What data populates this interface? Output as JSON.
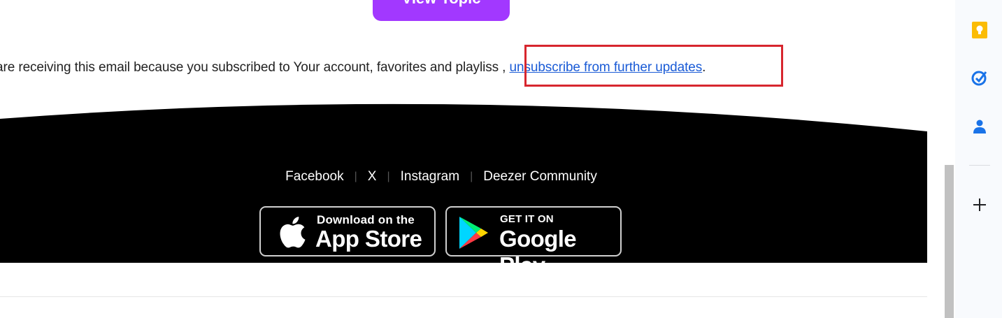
{
  "email": {
    "cta_label": "View Topic",
    "notice_text": "are receiving this email because you subscribed to Your account, favorites and playlis",
    "notice_gap": "s , ",
    "unsubscribe_link": "unsubscribe from further updates",
    "notice_end": "."
  },
  "footer": {
    "social_links": [
      {
        "label": "Facebook"
      },
      {
        "label": "X"
      },
      {
        "label": "Instagram"
      },
      {
        "label": "Deezer Community"
      }
    ],
    "separator": "|",
    "app_store": {
      "small": "Download on the",
      "big": "App Store"
    },
    "google_play": {
      "small": "GET IT ON",
      "big": "Google Play"
    }
  },
  "side_panel": {
    "icons": [
      "keep-icon",
      "tasks-icon",
      "contacts-icon",
      "add-icon"
    ]
  },
  "colors": {
    "cta": "#a238ff",
    "link": "#1a5bd6",
    "highlight": "#d7262e",
    "footer_bg": "#000000"
  }
}
